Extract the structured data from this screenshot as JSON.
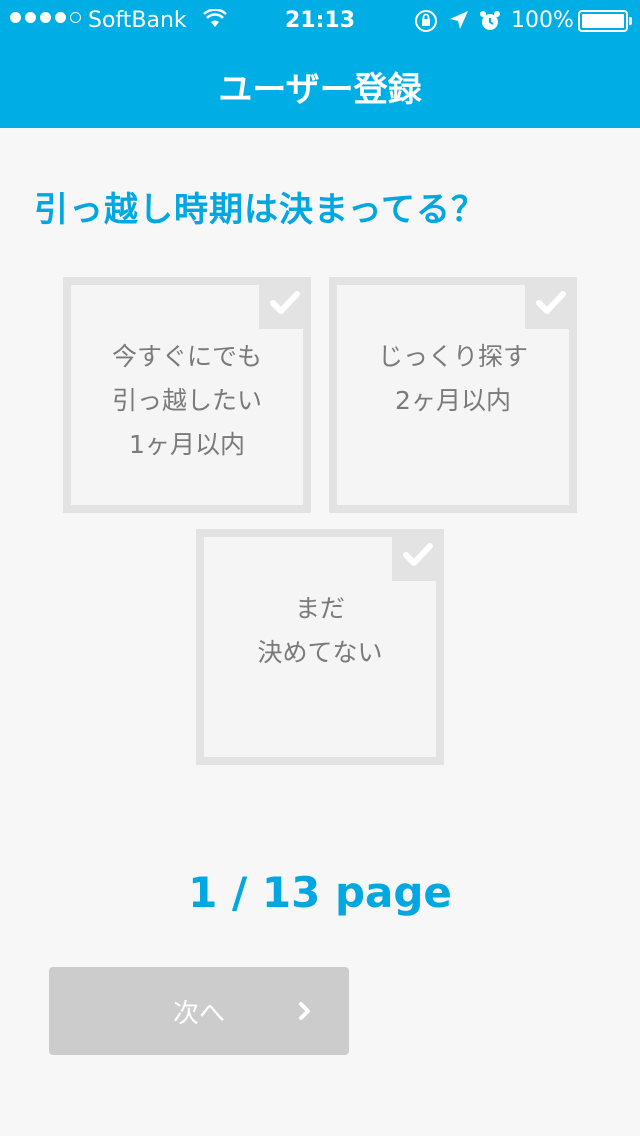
{
  "status": {
    "carrier": "SoftBank",
    "time": "21:13",
    "battery": "100%",
    "signal_bars_filled": 4,
    "signal_bars_total": 5
  },
  "nav": {
    "title": "ユーザー登録"
  },
  "question": "引っ越し時期は決まってる？",
  "options": [
    {
      "lines": [
        "今すぐにでも",
        "引っ越したい",
        "1ヶ月以内"
      ],
      "selected": false
    },
    {
      "lines": [
        "じっくり探す",
        "2ヶ月以内"
      ],
      "selected": false
    },
    {
      "lines": [
        "まだ",
        "決めてない"
      ],
      "selected": false
    }
  ],
  "pager": {
    "text": "1 / 13 page"
  },
  "next_button": {
    "label": "次へ"
  },
  "colors": {
    "accent": "#00aee6",
    "text_accent": "#00a7e1",
    "button_disabled": "#cccccc"
  }
}
